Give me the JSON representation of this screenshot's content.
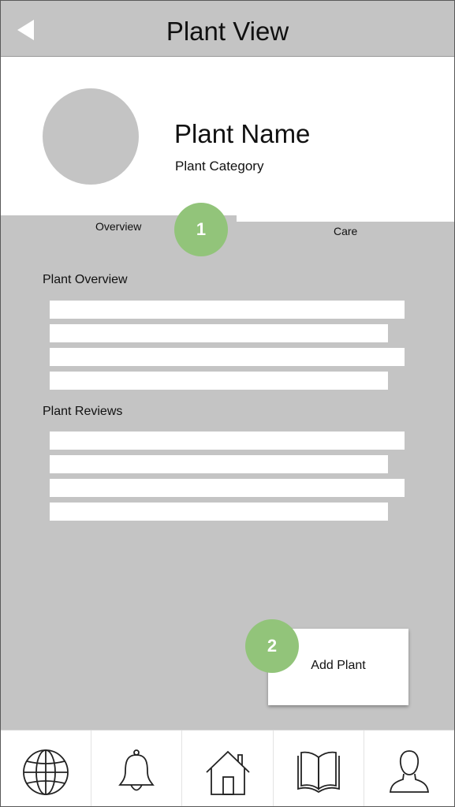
{
  "header": {
    "title": "Plant View",
    "back_icon": "back-arrow-icon"
  },
  "profile": {
    "name": "Plant Name",
    "category": "Plant Category"
  },
  "tabs": [
    {
      "label": "Overview",
      "selected": true
    },
    {
      "label": "Care",
      "selected": false
    }
  ],
  "badges": [
    "1",
    "2"
  ],
  "sections": {
    "overview_title": "Plant Overview",
    "reviews_title": "Plant Reviews"
  },
  "add_plant": {
    "label": "Add Plant"
  },
  "bottom_nav": {
    "items": [
      {
        "icon": "globe-icon"
      },
      {
        "icon": "bell-icon"
      },
      {
        "icon": "home-icon"
      },
      {
        "icon": "book-icon"
      },
      {
        "icon": "user-icon"
      }
    ]
  },
  "colors": {
    "header_bg": "#c4c4c4",
    "content_bg": "#c4c4c4",
    "badge": "#92c47a",
    "placeholder": "#ffffff"
  }
}
